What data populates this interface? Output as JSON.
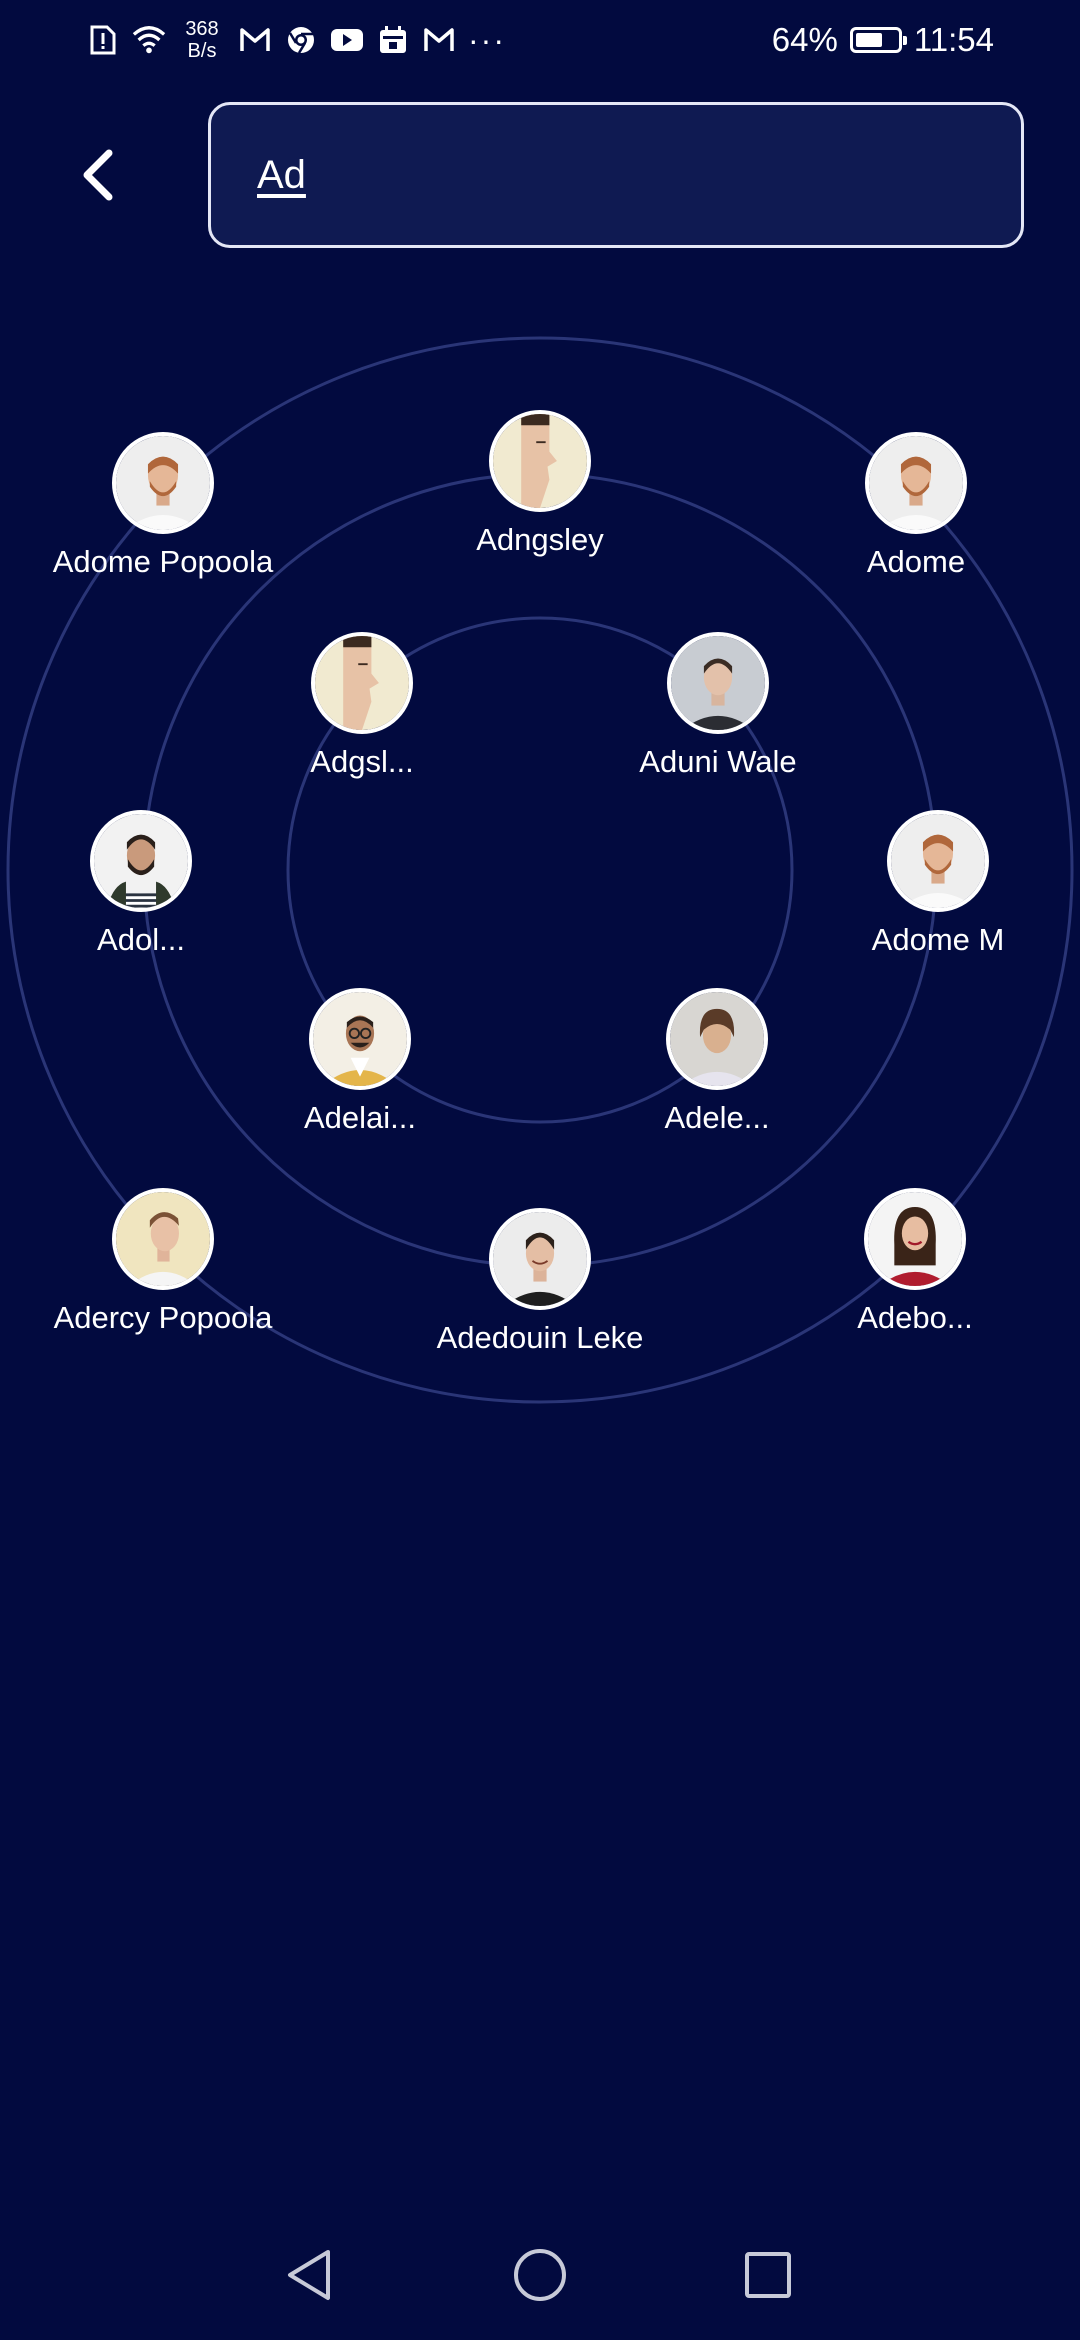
{
  "status_bar": {
    "network_speed_value": "368",
    "network_speed_unit": "B/s",
    "overflow": "···",
    "battery_percent": "64%",
    "battery_level": 0.64,
    "time": "11:54",
    "icons": [
      "alert-sim-icon",
      "wifi-icon",
      "gmail-icon",
      "chrome-icon",
      "youtube-icon",
      "calendar-icon",
      "gmail-icon"
    ]
  },
  "header": {
    "back_icon": "chevron-left-icon",
    "search_value": "Ad"
  },
  "contacts": [
    {
      "name": "Adngsley",
      "avatar": "face-cutout-yellow"
    },
    {
      "name": "Adome Popoola",
      "avatar": "red-beard-white-shirt"
    },
    {
      "name": "Adome",
      "avatar": "red-beard-white-shirt"
    },
    {
      "name": "Adgsl...",
      "avatar": "face-cutout-yellow"
    },
    {
      "name": "Aduni Wale",
      "avatar": "man-dark-shirt"
    },
    {
      "name": "Adol...",
      "avatar": "bearded-striped-shirt"
    },
    {
      "name": "Adome M",
      "avatar": "red-beard-white-shirt"
    },
    {
      "name": "Adelai...",
      "avatar": "glasses-yellow-jacket"
    },
    {
      "name": "Adele...",
      "avatar": "man-long-hair"
    },
    {
      "name": "Adercy Popoola",
      "avatar": "man-cream-background"
    },
    {
      "name": "Adedouin Leke",
      "avatar": "smiling-man-black-shirt"
    },
    {
      "name": "Adebo...",
      "avatar": "woman-red-top"
    }
  ],
  "nav_bar": {
    "back_icon": "triangle-back-icon",
    "home_icon": "circle-home-icon",
    "recents_icon": "square-recents-icon"
  },
  "colors": {
    "background": "#020a3f",
    "search_bg": "#0f1a52",
    "ring": "#2a3577"
  }
}
